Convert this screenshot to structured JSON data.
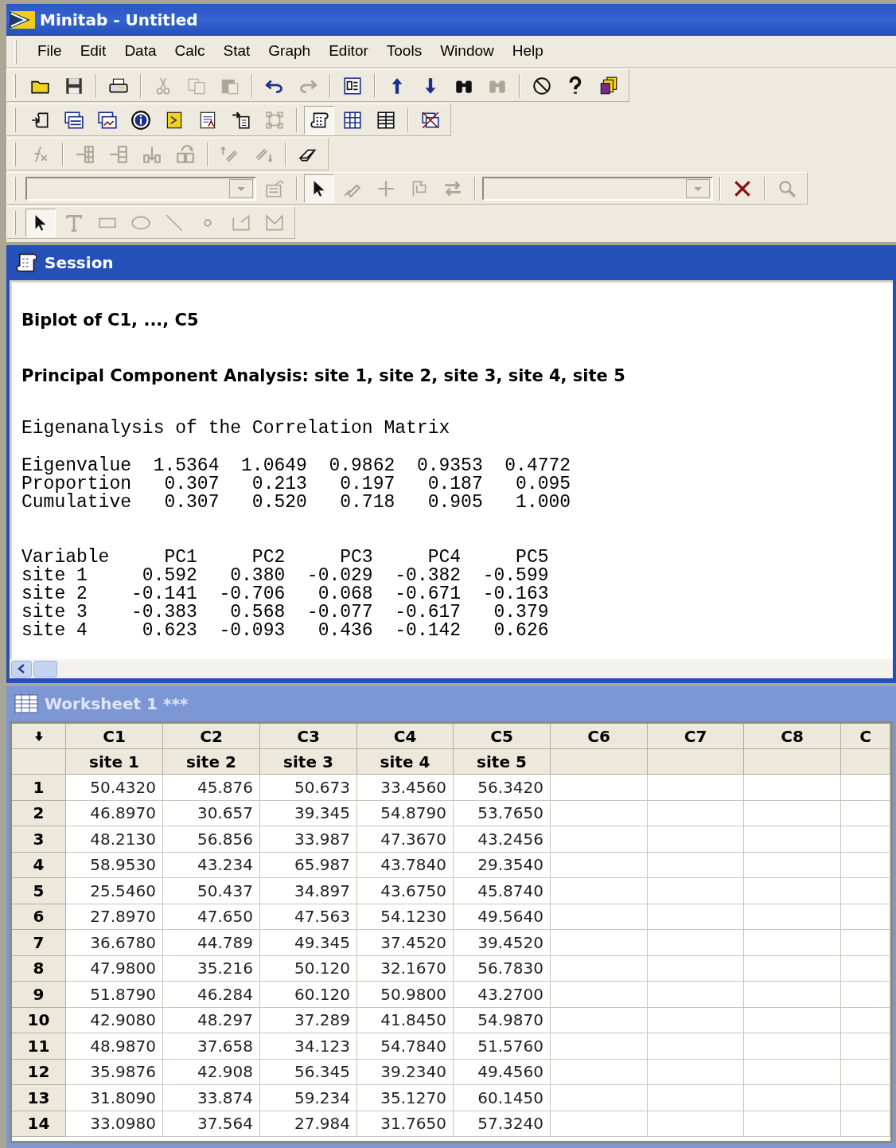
{
  "window": {
    "title": "Minitab - Untitled"
  },
  "menu": [
    "File",
    "Edit",
    "Data",
    "Calc",
    "Stat",
    "Graph",
    "Editor",
    "Tools",
    "Window",
    "Help"
  ],
  "toolbars": [
    [
      {
        "kind": "folder",
        "disabled": false
      },
      {
        "kind": "floppy-disk",
        "disabled": false
      },
      {
        "kind": "separator"
      },
      {
        "kind": "printer",
        "disabled": false
      },
      {
        "kind": "separator"
      },
      {
        "kind": "scissors",
        "disabled": true
      },
      {
        "kind": "copy",
        "disabled": true
      },
      {
        "kind": "paste",
        "disabled": true
      },
      {
        "kind": "separator"
      },
      {
        "kind": "undo",
        "disabled": false
      },
      {
        "kind": "redo",
        "disabled": true
      },
      {
        "kind": "separator"
      },
      {
        "kind": "panel",
        "disabled": false
      },
      {
        "kind": "separator"
      },
      {
        "kind": "up-arrow",
        "disabled": false
      },
      {
        "kind": "down-arrow",
        "disabled": false
      },
      {
        "kind": "binoculars",
        "disabled": false
      },
      {
        "kind": "binoculars",
        "disabled": true
      },
      {
        "kind": "separator"
      },
      {
        "kind": "no-sign",
        "disabled": false
      },
      {
        "kind": "question-mark",
        "disabled": false
      },
      {
        "kind": "stacked-pages",
        "disabled": false
      }
    ],
    [
      {
        "kind": "scroll-arrow",
        "disabled": false
      },
      {
        "kind": "window-stack",
        "disabled": false
      },
      {
        "kind": "chart-window",
        "disabled": false
      },
      {
        "kind": "info",
        "disabled": false
      },
      {
        "kind": "note",
        "disabled": false
      },
      {
        "kind": "report",
        "disabled": false
      },
      {
        "kind": "arrow-document",
        "disabled": false
      },
      {
        "kind": "node-frame",
        "disabled": true
      },
      {
        "kind": "separator"
      },
      {
        "kind": "scroll",
        "disabled": false,
        "pressed": true
      },
      {
        "kind": "grid",
        "disabled": false
      },
      {
        "kind": "table",
        "disabled": false
      },
      {
        "kind": "separator"
      },
      {
        "kind": "crossed-window",
        "disabled": false
      }
    ],
    [
      {
        "kind": "function",
        "disabled": true
      },
      {
        "kind": "separator"
      },
      {
        "kind": "insert-rows",
        "disabled": true
      },
      {
        "kind": "insert-columns",
        "disabled": true
      },
      {
        "kind": "bar-down",
        "disabled": true
      },
      {
        "kind": "bar-move",
        "disabled": true
      },
      {
        "kind": "separator"
      },
      {
        "kind": "brush-up",
        "disabled": true
      },
      {
        "kind": "brush-down",
        "disabled": true
      },
      {
        "kind": "separator"
      },
      {
        "kind": "eraser",
        "disabled": false
      }
    ],
    [
      {
        "kind": "dropdown"
      },
      {
        "kind": "form",
        "disabled": true
      },
      {
        "kind": "separator"
      },
      {
        "kind": "pointer",
        "disabled": false,
        "pressed": true
      },
      {
        "kind": "brush",
        "disabled": true
      },
      {
        "kind": "plus",
        "disabled": true
      },
      {
        "kind": "flag",
        "disabled": true
      },
      {
        "kind": "swap-arrows",
        "disabled": true
      },
      {
        "kind": "separator"
      },
      {
        "kind": "dropdown"
      },
      {
        "kind": "separator"
      },
      {
        "kind": "x-mark",
        "disabled": false
      },
      {
        "kind": "separator"
      },
      {
        "kind": "magnifier",
        "disabled": true
      }
    ],
    [
      {
        "kind": "pointer",
        "disabled": false,
        "pressed": true
      },
      {
        "kind": "t-tool",
        "disabled": true
      },
      {
        "kind": "rectangle",
        "disabled": true
      },
      {
        "kind": "ellipse",
        "disabled": true
      },
      {
        "kind": "line",
        "disabled": true
      },
      {
        "kind": "dot",
        "disabled": true
      },
      {
        "kind": "polygon",
        "disabled": true
      },
      {
        "kind": "polyline",
        "disabled": true
      }
    ]
  ],
  "session": {
    "title": "Session",
    "blocks": [
      {
        "kind": "heading",
        "text": "Biplot of C1, ..., C5"
      },
      {
        "kind": "heading",
        "text": "Principal Component Analysis: site 1, site 2, site 3, site 4, site 5"
      },
      {
        "kind": "output",
        "lines": [
          "Eigenanalysis of the Correlation Matrix"
        ]
      },
      {
        "kind": "output",
        "lines": [
          "Eigenvalue  1.5364  1.0649  0.9862  0.9353  0.4772",
          "Proportion   0.307   0.213   0.197   0.187   0.095",
          "Cumulative   0.307   0.520   0.718   0.905   1.000"
        ]
      },
      {
        "kind": "output",
        "lines": [
          "Variable     PC1     PC2     PC3     PC4     PC5",
          "site 1     0.592   0.380  -0.029  -0.382  -0.599",
          "site 2    -0.141  -0.706   0.068  -0.671  -0.163",
          "site 3    -0.383   0.568  -0.077  -0.617   0.379",
          "site 4     0.623  -0.093   0.436  -0.142   0.626"
        ]
      }
    ]
  },
  "worksheet": {
    "title": "Worksheet 1 ***",
    "columns": [
      {
        "id": "C1",
        "name": "site 1"
      },
      {
        "id": "C2",
        "name": "site 2"
      },
      {
        "id": "C3",
        "name": "site 3"
      },
      {
        "id": "C4",
        "name": "site 4"
      },
      {
        "id": "C5",
        "name": "site 5"
      },
      {
        "id": "C6"
      },
      {
        "id": "C7"
      },
      {
        "id": "C8"
      },
      {
        "id": "C"
      }
    ],
    "rows": [
      {
        "label": "1",
        "cells": [
          "50.4320",
          "45.876",
          "50.673",
          "33.4560",
          "56.3420"
        ]
      },
      {
        "label": "2",
        "cells": [
          "46.8970",
          "30.657",
          "39.345",
          "54.8790",
          "53.7650"
        ]
      },
      {
        "label": "3",
        "cells": [
          "48.2130",
          "56.856",
          "33.987",
          "47.3670",
          "43.2456"
        ]
      },
      {
        "label": "4",
        "cells": [
          "58.9530",
          "43.234",
          "65.987",
          "43.7840",
          "29.3540"
        ]
      },
      {
        "label": "5",
        "cells": [
          "25.5460",
          "50.437",
          "34.897",
          "43.6750",
          "45.8740"
        ]
      },
      {
        "label": "6",
        "cells": [
          "27.8970",
          "47.650",
          "47.563",
          "54.1230",
          "49.5640"
        ]
      },
      {
        "label": "7",
        "cells": [
          "36.6780",
          "44.789",
          "49.345",
          "37.4520",
          "39.4520"
        ]
      },
      {
        "label": "8",
        "cells": [
          "47.9800",
          "35.216",
          "50.120",
          "32.1670",
          "56.7830"
        ]
      },
      {
        "label": "9",
        "cells": [
          "51.8790",
          "46.284",
          "60.120",
          "50.9800",
          "43.2700"
        ]
      },
      {
        "label": "10",
        "cells": [
          "42.9080",
          "48.297",
          "37.289",
          "41.8450",
          "54.9870"
        ]
      },
      {
        "label": "11",
        "cells": [
          "48.9870",
          "37.658",
          "34.123",
          "54.7840",
          "51.5760"
        ]
      },
      {
        "label": "12",
        "cells": [
          "35.9876",
          "42.908",
          "56.345",
          "39.2340",
          "49.4560"
        ]
      },
      {
        "label": "13",
        "cells": [
          "31.8090",
          "33.874",
          "59.234",
          "35.1270",
          "60.1450"
        ]
      },
      {
        "label": "14",
        "cells": [
          "33.0980",
          "37.564",
          "27.984",
          "31.7650",
          "57.3240"
        ]
      }
    ]
  }
}
